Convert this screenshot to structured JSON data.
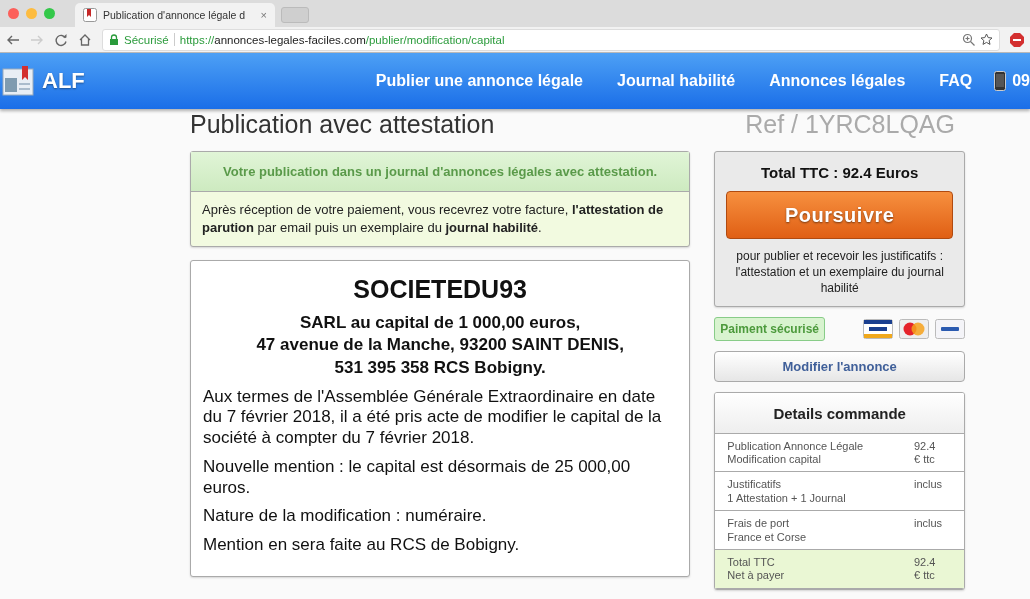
{
  "browser": {
    "tab_title": "Publication d'annonce légale d",
    "tab_close": "×",
    "security": "Sécurisé",
    "url": "https://**annonces-legales-faciles.com**/publier/modification/capital"
  },
  "navbar": {
    "logo": "ALF",
    "links": [
      {
        "label": "Publier une annonce légale"
      },
      {
        "label": "Journal habilité"
      },
      {
        "label": "Annonces légales"
      },
      {
        "label": "FAQ"
      }
    ],
    "phone": "09"
  },
  "page": {
    "title": "Publication avec attestation",
    "reference": "Ref / 1YRC8LQAG"
  },
  "notice": {
    "title": "Votre publication dans un journal d'annonces légales avec attestation.",
    "body": "Après réception de votre paiement, vous recevrez votre facture, **l'attestation de parution** par email puis un exemplaire du **journal habilité**."
  },
  "announcement": {
    "company": "SOCIETEDU93",
    "header_lines": [
      "SARL au capital de 1 000,00 euros,",
      "47 avenue de la Manche, 93200 SAINT DENIS,",
      "531 395 358 RCS Bobigny."
    ],
    "paragraphs": [
      "Aux termes de l'Assemblée Générale Extraordinaire en date du 7 février 2018, il a été pris acte de modifier le capital de la société à compter du 7 février 2018.",
      "Nouvelle mention : le capital est désormais de 25 000,00 euros.",
      "Nature de la modification : numéraire.",
      "Mention en sera faite au RCS de Bobigny."
    ]
  },
  "order": {
    "total": "Total TTC : 92.4 Euros",
    "button": "Poursuivre",
    "note": "pour publier et recevoir les justificatifs : l'attestation et un exemplaire du journal habilité",
    "secure_badge": "Paiment sécurisé",
    "modify_button": "Modifier l'annonce"
  },
  "details": {
    "title": "Details commande",
    "rows": [
      {
        "label": [
          "Publication Annonce Légale",
          "Modification capital"
        ],
        "value": [
          "92.4",
          "€ ttc"
        ],
        "highlighted": false
      },
      {
        "label": [
          "Justificatifs",
          "1 Attestation + 1 Journal"
        ],
        "value": [
          "inclus"
        ],
        "highlighted": false
      },
      {
        "label": [
          "Frais de port",
          "France et Corse"
        ],
        "value": [
          "inclus"
        ],
        "highlighted": false
      },
      {
        "label": [
          "Total TTC",
          "Net à payer"
        ],
        "value": [
          "92.4",
          "€ ttc"
        ],
        "highlighted": true
      }
    ]
  }
}
